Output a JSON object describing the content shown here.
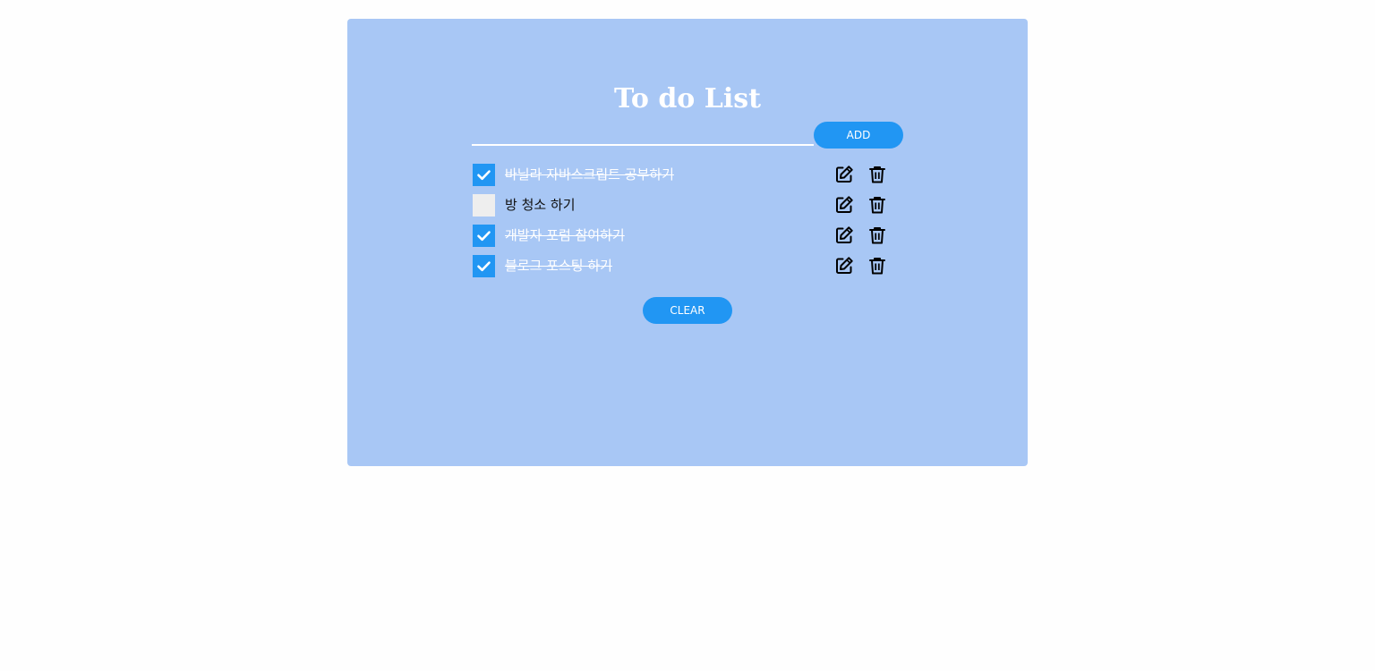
{
  "app": {
    "title": "To do List"
  },
  "input": {
    "value": "",
    "placeholder": "",
    "add_label": "ADD"
  },
  "todos": [
    {
      "text": "바닐라 자바스크립트 공부하기",
      "done": true
    },
    {
      "text": "방 청소 하기",
      "done": false
    },
    {
      "text": "개발자 포럼 참여하기",
      "done": true
    },
    {
      "text": "블로그 포스팅 하기",
      "done": true
    }
  ],
  "icons": {
    "check": "check-icon",
    "edit": "edit-icon",
    "delete": "trash-icon"
  },
  "footer": {
    "clear_label": "CLEAR"
  },
  "colors": {
    "card_bg": "#a8c7f5",
    "accent": "#2196f3",
    "page_bg": "#fefefe"
  }
}
